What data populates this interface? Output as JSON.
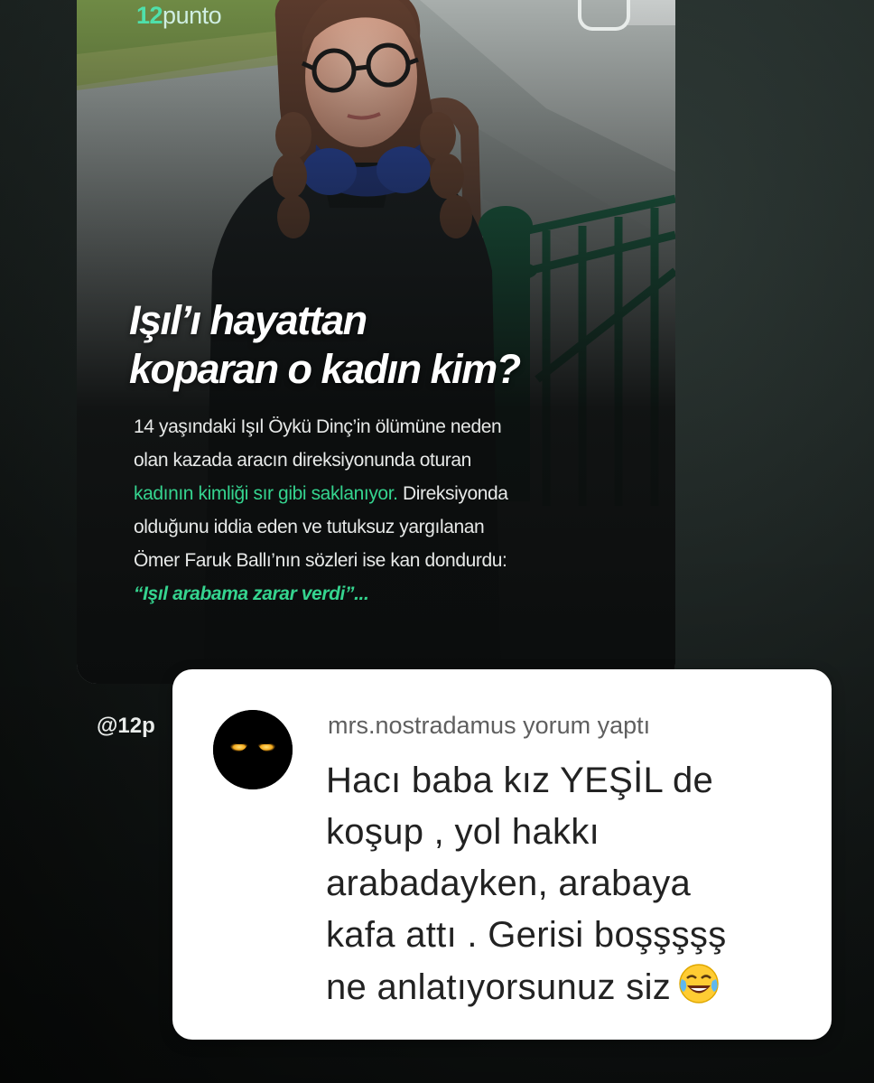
{
  "post": {
    "logo_brand": "12",
    "logo_suffix": "punto",
    "headline_line1": "Işıl’ı hayattan",
    "headline_line2": "koparan o kadın kim?",
    "summary": {
      "line1": "14 yaşındaki Işıl Öykü Dinç’in ölümüne neden",
      "line2": "olan kazada aracın direksiyonunda oturan",
      "line3_highlight": "kadının kimliği sır gibi saklanıyor.",
      "line3_rest": " Direksiyonda",
      "line4": "olduğunu iddia eden ve tutuksuz yargılanan",
      "line5": "Ömer Faruk Ballı’nın sözleri ise kan dondurdu:",
      "quote": "“Işıl arabama zarar verdi”..."
    },
    "handle": "@12p"
  },
  "comment": {
    "header": "mrs.nostradamus yorum yaptı",
    "lines": [
      "Hacı baba kız YEŞİL de",
      "koşup , yol hakkı",
      "arabadayken, arabaya",
      "kafa attı . Gerisi boşşşşş",
      "ne anlatıyorsunuz siz"
    ],
    "emoji": "face-with-tears-of-joy-icon"
  },
  "colors": {
    "accent_green": "#35d48f",
    "logo_green": "#4fe0ab",
    "comment_bg": "#ffffff"
  }
}
